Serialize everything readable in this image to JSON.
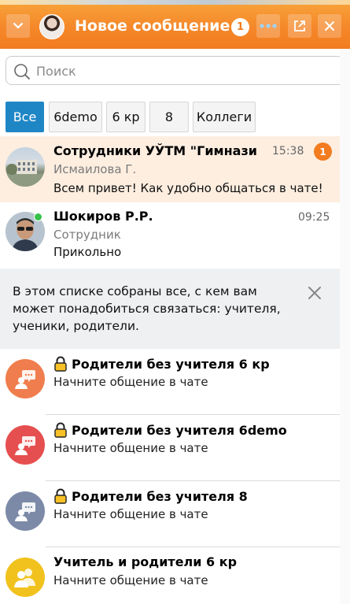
{
  "header": {
    "title": "Новое сообщение",
    "unread_count": "1",
    "colors": {
      "accent": "#f27c1f",
      "badge_bg": "#ffffff"
    },
    "icons": [
      "chevron-down-icon",
      "more-icon",
      "external-link-icon",
      "close-icon"
    ]
  },
  "search": {
    "placeholder": "Поиск",
    "value": ""
  },
  "filters": [
    {
      "label": "Все",
      "active": true
    },
    {
      "label": "6demo",
      "active": false
    },
    {
      "label": "6 кр",
      "active": false
    },
    {
      "label": "8",
      "active": false
    },
    {
      "label": "Коллеги",
      "active": false
    }
  ],
  "chats": [
    {
      "name": "Сотрудники УЎТМ \"Гимнази",
      "sender": "Исмаилова Г.",
      "message": "Всем привет! Как удобно общаться в чате!",
      "time": "15:38",
      "unread": "1",
      "highlighted": true
    },
    {
      "name": "Шокиров Р.Р.",
      "sender": "Сотрудник",
      "message": "Прикольно",
      "time": "09:25",
      "online": true
    }
  ],
  "info_banner": {
    "text": "В этом списке собраны все, с кем вам может понадобиться связаться: учителя, ученики, родители."
  },
  "groups": [
    {
      "name": "Родители без учителя 6 кр",
      "subtitle": "Начните общение в чате",
      "locked": true,
      "color": "#f07d4d"
    },
    {
      "name": "Родители без учителя 6demo",
      "subtitle": "Начните общение в чате",
      "locked": true,
      "color": "#e64f4f"
    },
    {
      "name": "Родители без учителя 8",
      "subtitle": "Начните общение в чате",
      "locked": true,
      "color": "#7c8aa8"
    },
    {
      "name": "Учитель и родители 6 кр",
      "subtitle": "Начните общение в чате",
      "locked": false,
      "color": "#f1c21d"
    }
  ]
}
